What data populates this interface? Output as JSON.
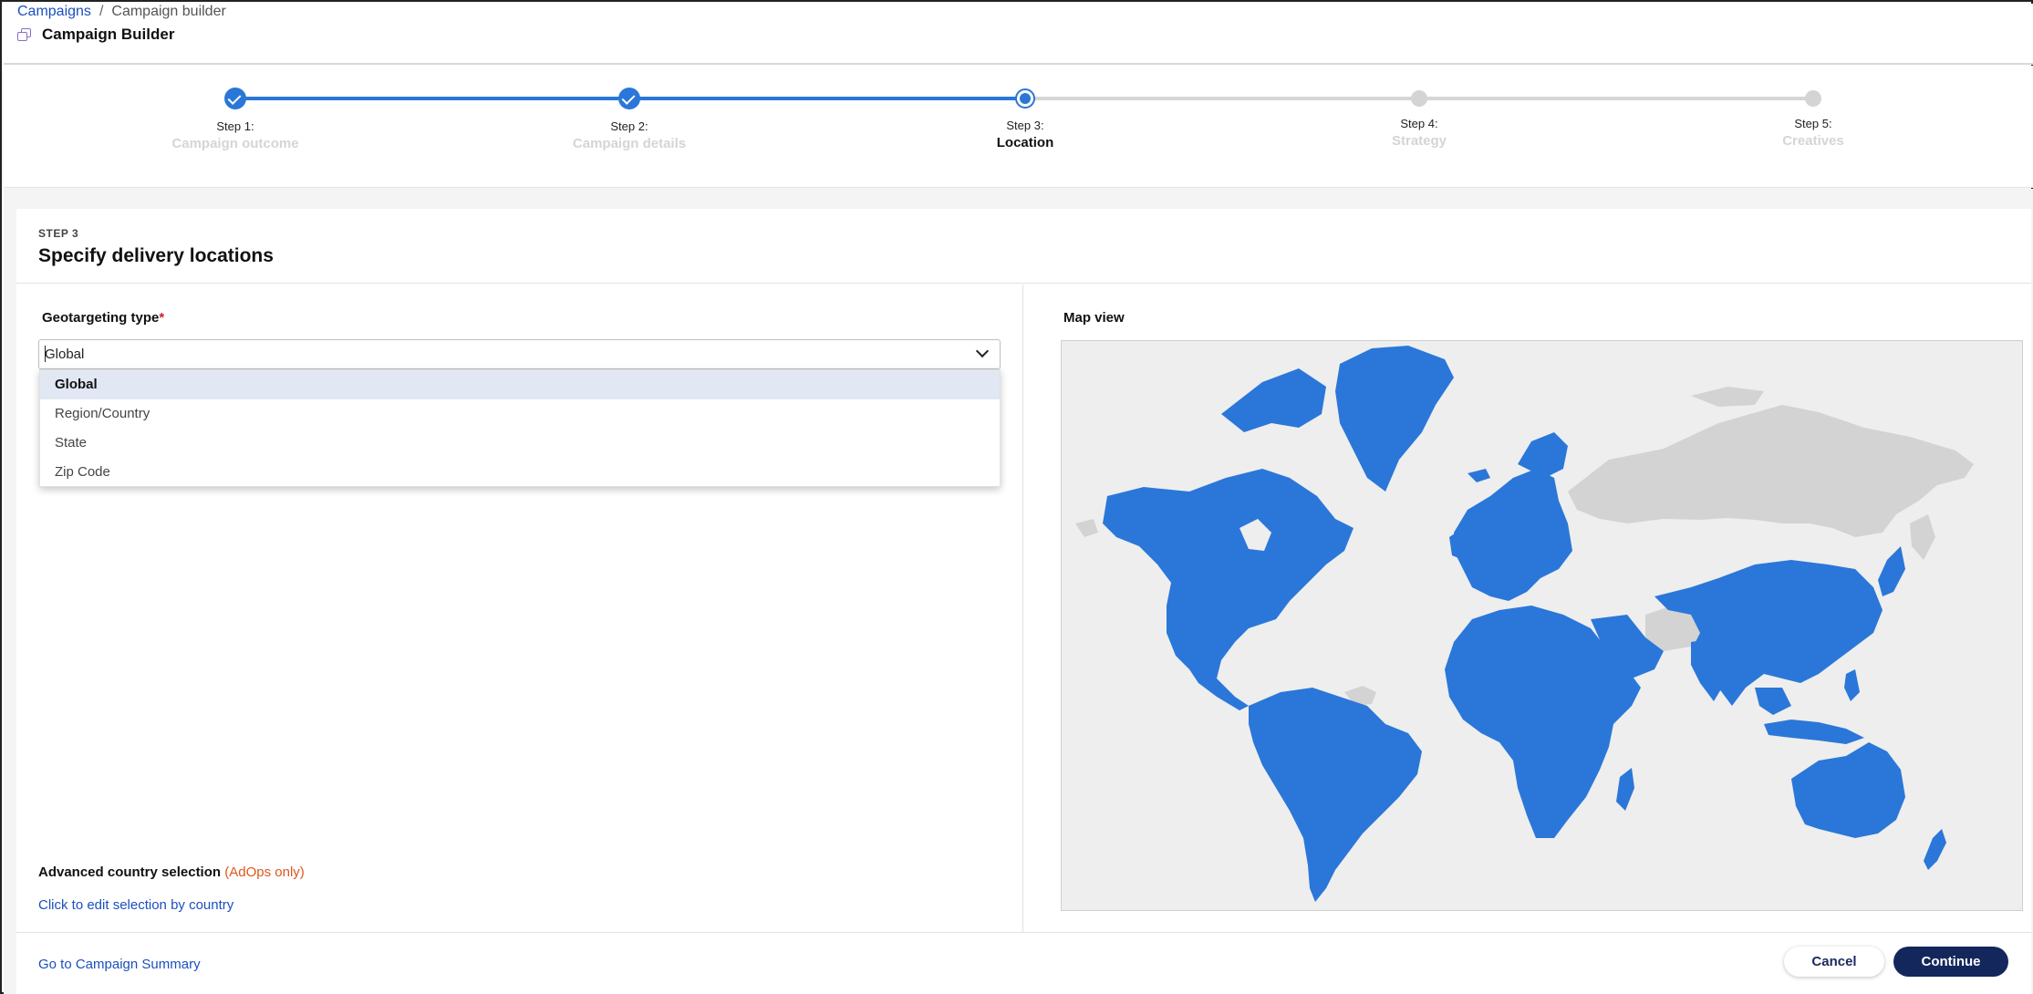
{
  "breadcrumb": {
    "parent": "Campaigns",
    "separator": "/",
    "current": "Campaign builder"
  },
  "header": {
    "title": "Campaign Builder",
    "icon": "campaign-icon"
  },
  "stepper": {
    "steps": [
      {
        "number": "Step 1:",
        "name": "Campaign outcome",
        "status": "complete"
      },
      {
        "number": "Step 2:",
        "name": "Campaign details",
        "status": "complete"
      },
      {
        "number": "Step 3:",
        "name": "Location",
        "status": "current"
      },
      {
        "number": "Step 4:",
        "name": "Strategy",
        "status": "upcoming"
      },
      {
        "number": "Step 5:",
        "name": "Creatives",
        "status": "upcoming"
      }
    ]
  },
  "section": {
    "kicker": "STEP 3",
    "title": "Specify delivery locations"
  },
  "geotargeting": {
    "label": "Geotargeting type",
    "required_mark": "*",
    "value": "Global",
    "options": [
      "Global",
      "Region/Country",
      "State",
      "Zip Code"
    ],
    "selected_option": "Global"
  },
  "advanced": {
    "label": "Advanced country selection",
    "note": "(AdOps only)",
    "link": "Click to edit selection by country"
  },
  "map": {
    "label": "Map view",
    "selected_color": "#2a77d9",
    "unselected_color": "#d3d3d3"
  },
  "footer": {
    "summary_link": "Go to Campaign Summary",
    "cancel": "Cancel",
    "continue": "Continue"
  },
  "colors": {
    "accent": "#2a77d9",
    "primary_button": "#13275c",
    "link": "#1b4fbf",
    "note": "#e0561d"
  }
}
